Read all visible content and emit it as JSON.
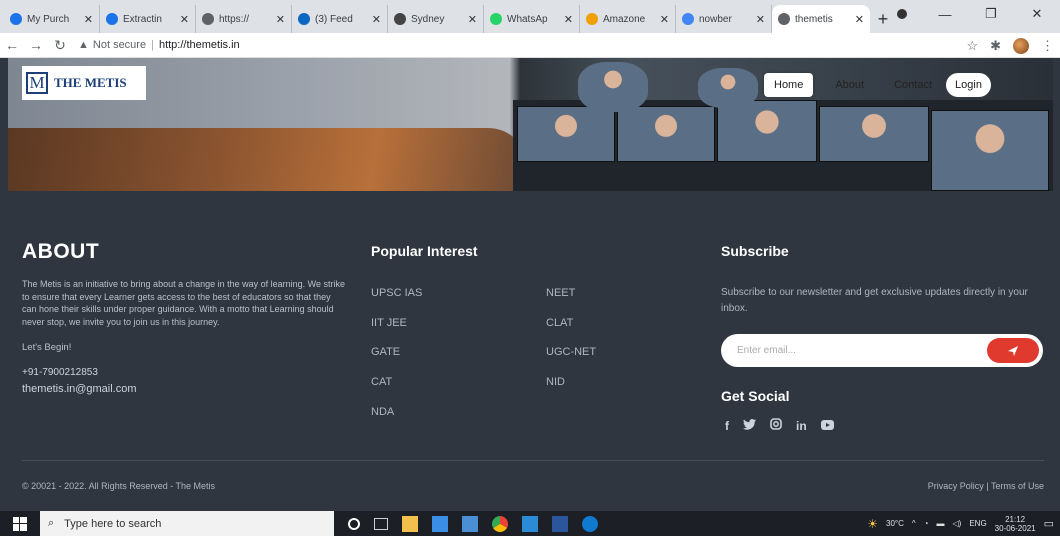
{
  "browser": {
    "tabs": [
      {
        "title": "My Purch",
        "fav": "#1a73e8"
      },
      {
        "title": "Extractin",
        "fav": "#1a73e8"
      },
      {
        "title": "https://",
        "fav": "#5f6368"
      },
      {
        "title": "(3) Feed",
        "fav": "#0a66c2"
      },
      {
        "title": "Sydney",
        "fav": "#444"
      },
      {
        "title": "WhatsAp",
        "fav": "#25d366"
      },
      {
        "title": "Amazone",
        "fav": "#f0a000"
      },
      {
        "title": "nowber",
        "fav": "#4285f4"
      },
      {
        "title": "themetis",
        "fav": "#5f6368"
      }
    ],
    "security_label": "Not secure",
    "url": "http://themetis.in"
  },
  "site": {
    "logo_mark": "M",
    "logo_text": "THE METIS",
    "nav": {
      "home": "Home",
      "about": "About",
      "contact": "Contact",
      "login": "Login"
    }
  },
  "about": {
    "heading": "ABOUT",
    "description": "The Metis is an initiative to bring about a change in the way of learning. We strike to ensure that every Learner gets access to the best of educators so that they can hone their skills under proper guidance. With a motto that Learning should never stop, we invite you to join us in this journey.",
    "lets_begin": "Let's Begin!",
    "phone": "+91-7900212853",
    "email": "themetis.in@gmail.com"
  },
  "popular": {
    "heading": "Popular Interest",
    "left": [
      "UPSC IAS",
      "IIT JEE",
      "GATE",
      "CAT",
      "NDA"
    ],
    "right": [
      "NEET",
      "CLAT",
      "UGC-NET",
      "NID"
    ]
  },
  "subscribe": {
    "heading": "Subscribe",
    "text": "Subscribe to our newsletter and get exclusive updates directly in your inbox.",
    "placeholder": "Enter email...",
    "social_heading": "Get Social",
    "social_icons": [
      "facebook-icon",
      "twitter-icon",
      "instagram-icon",
      "linkedin-icon",
      "youtube-icon"
    ]
  },
  "footer": {
    "copyright": "© 20021 - 2022. All Rights Reserved - The Metis",
    "legal": "Privacy Policy | Terms of Use"
  },
  "taskbar": {
    "search_placeholder": "Type here to search",
    "weather": "30°C",
    "lang": "ENG",
    "time": "21:12",
    "date": "30-06-2021"
  },
  "colors": {
    "accent_red": "#e03a2f",
    "footer_bg": "#2f3640",
    "logo_blue": "#1c3f77"
  }
}
